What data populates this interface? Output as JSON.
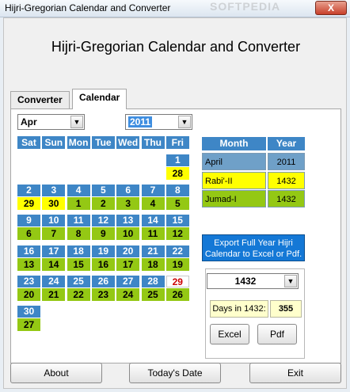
{
  "window": {
    "title": "Hijri-Gregorian Calendar and Converter",
    "close_label": "X",
    "watermark": "SOFTPEDIA"
  },
  "heading": "Hijri-Gregorian Calendar and Converter",
  "tabs": [
    {
      "label": "Converter",
      "active": false
    },
    {
      "label": "Calendar",
      "active": true
    }
  ],
  "month_select": {
    "value": "Apr"
  },
  "year_select": {
    "value": "2011"
  },
  "weekday_headers": [
    "Sat",
    "Sun",
    "Mon",
    "Tue",
    "Wed",
    "Thu",
    "Fri"
  ],
  "calendar": {
    "gregorian_color": "#3e86c6",
    "hijri_color": "#94c814",
    "highlight_hijri_color": "#ffff00",
    "today_color": "#cc0000",
    "cells": [
      {
        "g": "1",
        "h": "28",
        "col": 6,
        "row": 0,
        "hl": true
      },
      {
        "g": "2",
        "h": "29",
        "col": 0,
        "row": 1,
        "hl": true
      },
      {
        "g": "3",
        "h": "30",
        "col": 1,
        "row": 1,
        "hl": true
      },
      {
        "g": "4",
        "h": "1",
        "col": 2,
        "row": 1
      },
      {
        "g": "5",
        "h": "2",
        "col": 3,
        "row": 1
      },
      {
        "g": "6",
        "h": "3",
        "col": 4,
        "row": 1
      },
      {
        "g": "7",
        "h": "4",
        "col": 5,
        "row": 1
      },
      {
        "g": "8",
        "h": "5",
        "col": 6,
        "row": 1
      },
      {
        "g": "9",
        "h": "6",
        "col": 0,
        "row": 2
      },
      {
        "g": "10",
        "h": "7",
        "col": 1,
        "row": 2
      },
      {
        "g": "11",
        "h": "8",
        "col": 2,
        "row": 2
      },
      {
        "g": "12",
        "h": "9",
        "col": 3,
        "row": 2
      },
      {
        "g": "13",
        "h": "10",
        "col": 4,
        "row": 2
      },
      {
        "g": "14",
        "h": "11",
        "col": 5,
        "row": 2
      },
      {
        "g": "15",
        "h": "12",
        "col": 6,
        "row": 2
      },
      {
        "g": "16",
        "h": "13",
        "col": 0,
        "row": 3
      },
      {
        "g": "17",
        "h": "14",
        "col": 1,
        "row": 3
      },
      {
        "g": "18",
        "h": "15",
        "col": 2,
        "row": 3
      },
      {
        "g": "19",
        "h": "16",
        "col": 3,
        "row": 3
      },
      {
        "g": "20",
        "h": "17",
        "col": 4,
        "row": 3
      },
      {
        "g": "21",
        "h": "18",
        "col": 5,
        "row": 3
      },
      {
        "g": "22",
        "h": "19",
        "col": 6,
        "row": 3
      },
      {
        "g": "23",
        "h": "20",
        "col": 0,
        "row": 4
      },
      {
        "g": "24",
        "h": "21",
        "col": 1,
        "row": 4
      },
      {
        "g": "25",
        "h": "22",
        "col": 2,
        "row": 4
      },
      {
        "g": "26",
        "h": "23",
        "col": 3,
        "row": 4
      },
      {
        "g": "27",
        "h": "24",
        "col": 4,
        "row": 4
      },
      {
        "g": "28",
        "h": "25",
        "col": 5,
        "row": 4
      },
      {
        "g": "29",
        "h": "26",
        "col": 6,
        "row": 4,
        "today": true
      },
      {
        "g": "30",
        "h": "27",
        "col": 0,
        "row": 5
      }
    ]
  },
  "info_table": {
    "headers": [
      "Month",
      "Year"
    ],
    "rows": [
      {
        "month": "April",
        "year": "2011",
        "color": "#6fa0c8"
      },
      {
        "month": "Rabi'-II",
        "year": "1432",
        "color": "#ffff00"
      },
      {
        "month": "Jumad-I",
        "year": "1432",
        "color": "#94c814"
      }
    ]
  },
  "export_button": {
    "line1": "Export Full Year Hijri",
    "line2": "Calendar to Excel or Pdf."
  },
  "hijri_year_select": {
    "value": "1432"
  },
  "days_in_year": {
    "label": "Days in 1432:",
    "value": "355"
  },
  "export_buttons": {
    "excel": "Excel",
    "pdf": "Pdf"
  },
  "bottom_buttons": {
    "about": "About",
    "today": "Today's Date",
    "exit": "Exit"
  }
}
